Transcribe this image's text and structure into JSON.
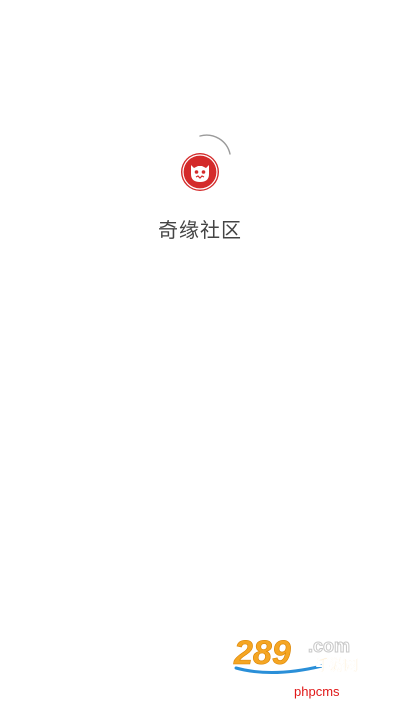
{
  "splash": {
    "app_name": "奇缘社区",
    "logo_icon": "monster-face-icon",
    "brand_color": "#e02020"
  },
  "watermark": {
    "logo_text": "289.com",
    "sub_text": "手游网",
    "footer_text": "phpcms",
    "orange_color": "#f5a623",
    "blue_color": "#2a8fd8"
  }
}
